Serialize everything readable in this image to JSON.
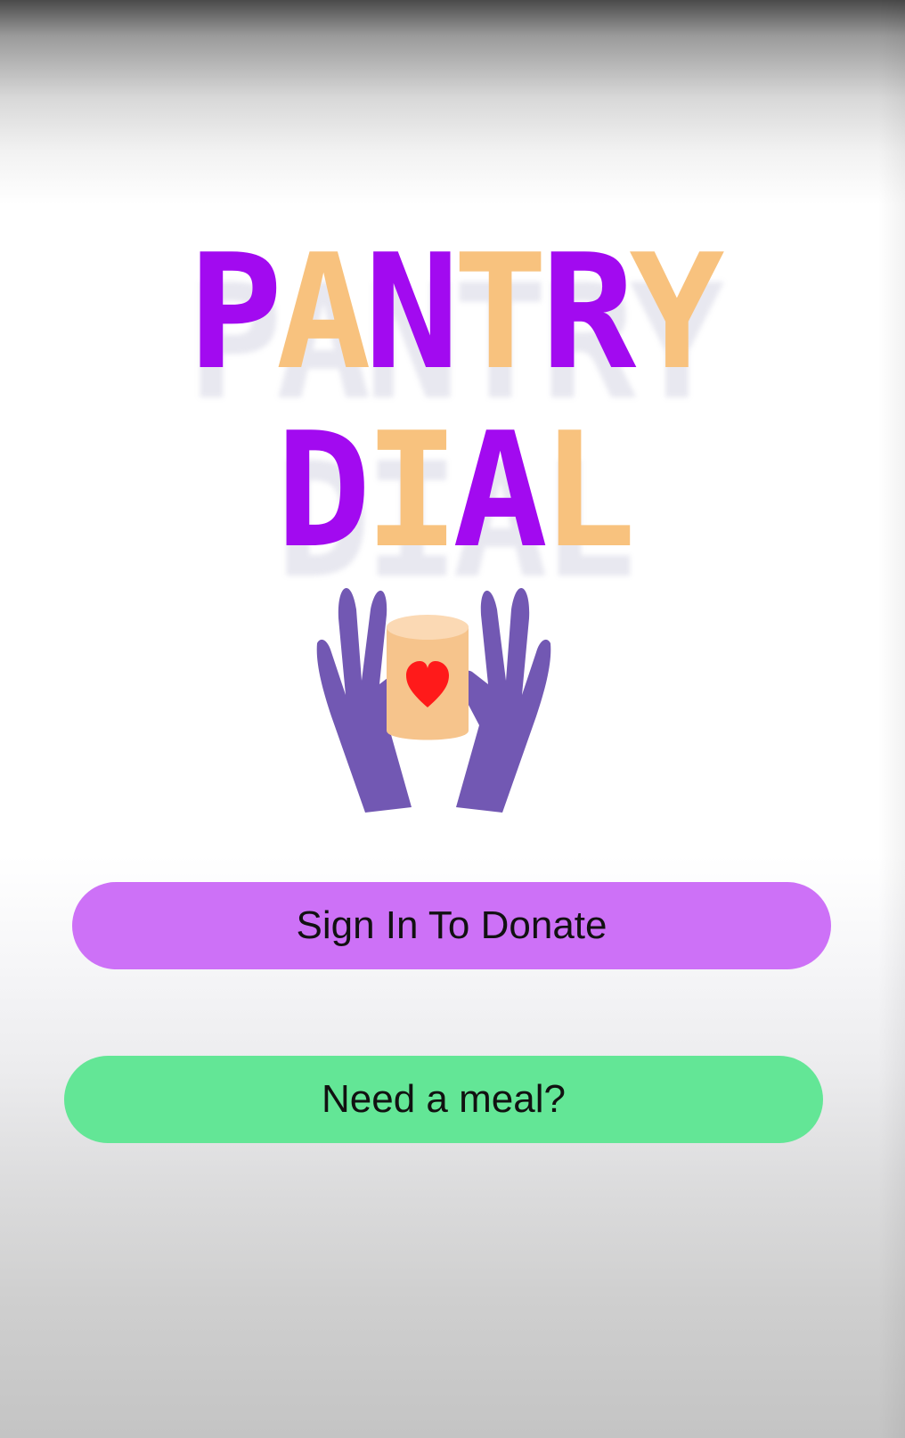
{
  "title": {
    "line1": [
      "P",
      "A",
      "N",
      "T",
      "R",
      "Y"
    ],
    "line2": [
      "D",
      "I",
      "A",
      "L"
    ]
  },
  "colors": {
    "purple": "#a20af0",
    "orange": "#f8c27e",
    "hands": "#7258b3",
    "jar": "#f6c48c",
    "heart": "#ff1a1a",
    "donate_button": "#cd71f7",
    "meal_button": "#63e696"
  },
  "logo": {
    "icon": "hands-holding-jar-with-heart"
  },
  "buttons": {
    "donate_label": "Sign In To Donate",
    "meal_label": "Need a meal?"
  }
}
